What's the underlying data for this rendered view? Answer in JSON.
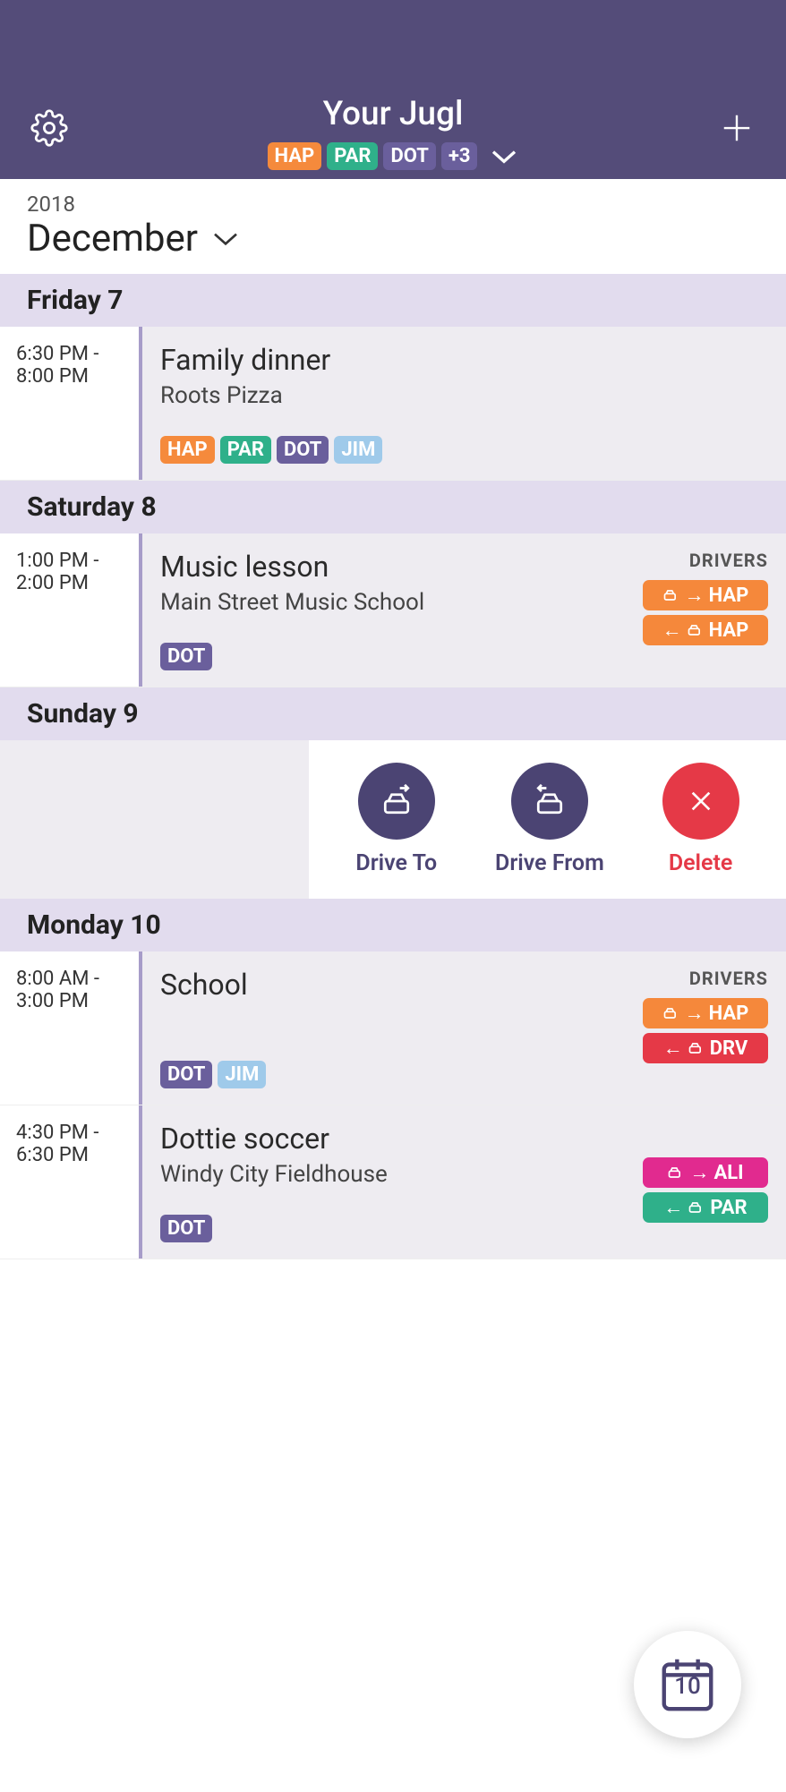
{
  "header": {
    "title": "Your Jugl",
    "tags": [
      "HAP",
      "PAR",
      "DOT"
    ],
    "more": "+3"
  },
  "dateBar": {
    "year": "2018",
    "month": "December"
  },
  "labels": {
    "drivers": "DRIVERS",
    "driveTo": "Drive To",
    "driveFrom": "Drive From",
    "delete": "Delete"
  },
  "days": {
    "fri": "Friday 7",
    "sat": "Saturday 8",
    "sun": "Sunday 9",
    "mon": "Monday 10"
  },
  "events": {
    "e1": {
      "start": "6:30 PM -",
      "end": "8:00 PM",
      "title": "Family dinner",
      "location": "Roots Pizza",
      "tags": [
        "HAP",
        "PAR",
        "DOT",
        "JIM"
      ]
    },
    "e2": {
      "start": "1:00 PM -",
      "end": "2:00 PM",
      "title": "Music lesson",
      "location": "Main Street Music School",
      "tags": [
        "DOT"
      ],
      "driverTo": "HAP",
      "driverFrom": "HAP"
    },
    "e3": {
      "start": "8:00 AM -",
      "end": "3:00 PM",
      "title": "School",
      "tags": [
        "DOT",
        "JIM"
      ],
      "driverTo": "HAP",
      "driverFrom": "DRV"
    },
    "e4": {
      "start": "4:30 PM -",
      "end": "6:30 PM",
      "title": "Dottie soccer",
      "location": "Windy City Fieldhouse",
      "tags": [
        "DOT"
      ],
      "driverTo": "ALI",
      "driverFrom": "PAR"
    }
  },
  "fab": {
    "day": "10"
  }
}
